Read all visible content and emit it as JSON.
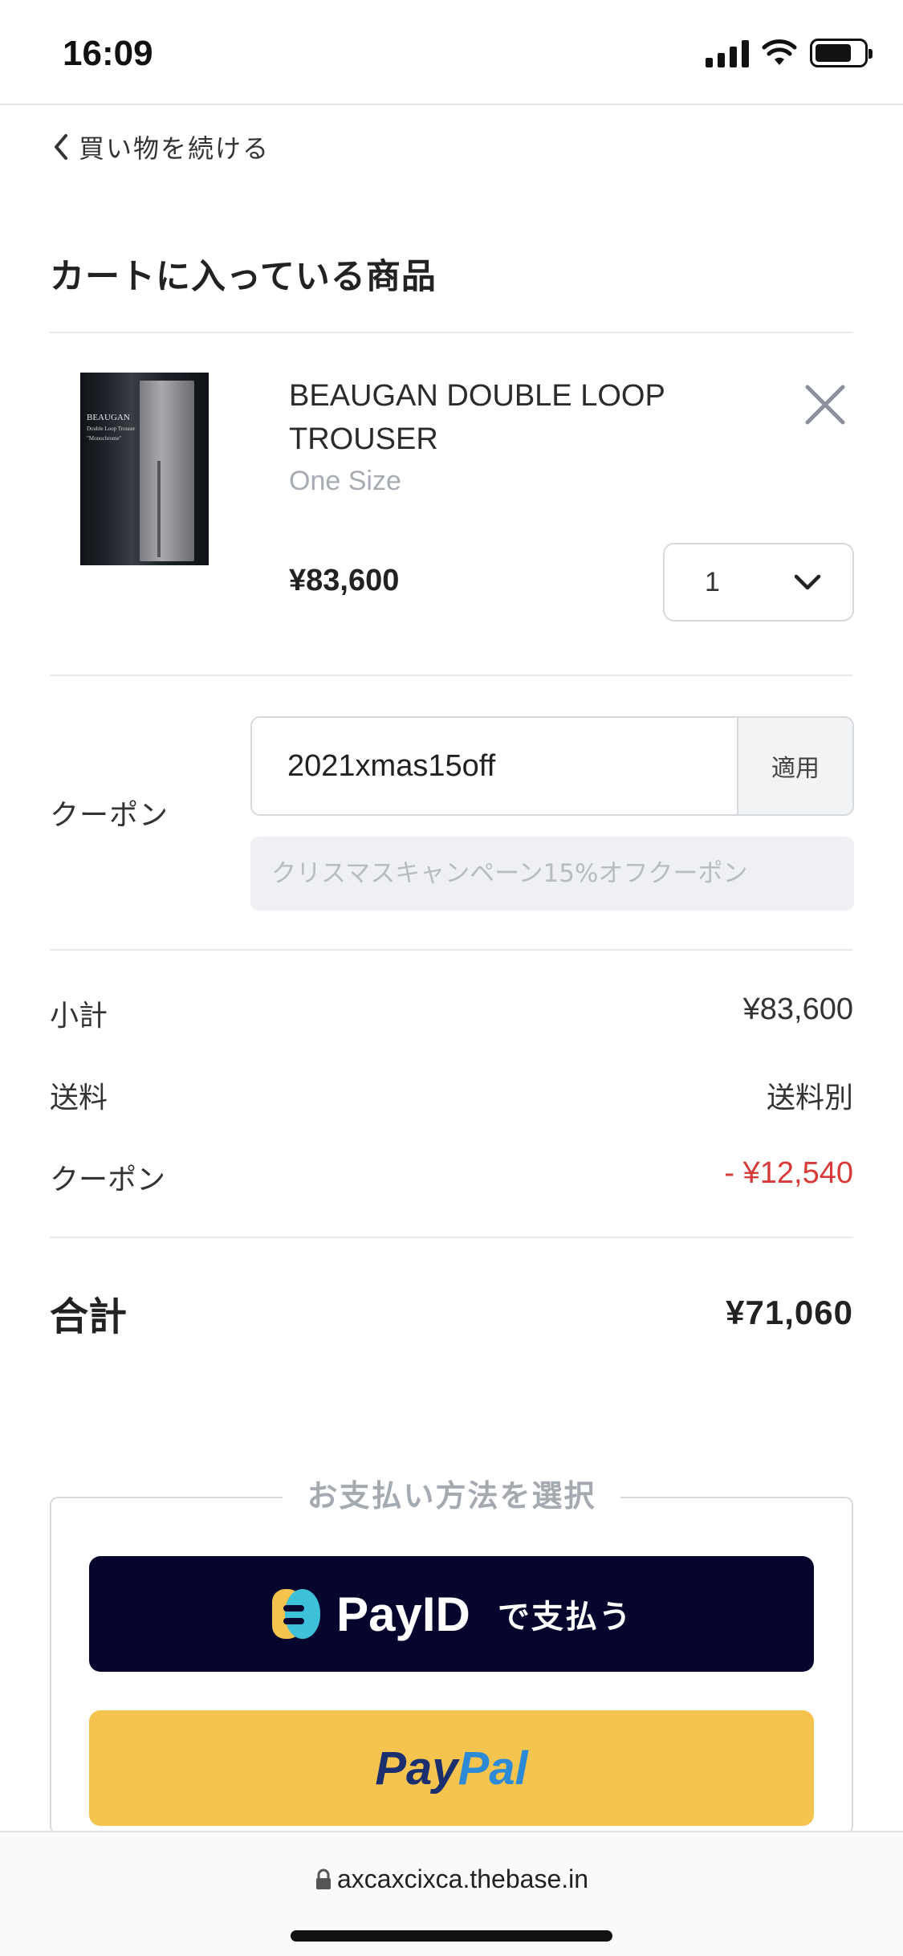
{
  "status_bar": {
    "time": "16:09"
  },
  "back_link": {
    "label": "買い物を続ける"
  },
  "cart": {
    "title": "カートに入っている商品"
  },
  "product": {
    "name": "BEAUGAN DOUBLE LOOP TROUSER",
    "variant": "One Size",
    "price": "¥83,600",
    "quantity": "1",
    "image_text": [
      "BEAUGAN",
      "Double Loop Trouser",
      "\"Monochrome\""
    ]
  },
  "coupon": {
    "label": "クーポン",
    "code": "2021xmas15off",
    "apply_label": "適用",
    "description": "クリスマスキャンペーン15%オフクーポン"
  },
  "summary": {
    "subtotal_label": "小計",
    "subtotal_value": "¥83,600",
    "shipping_label": "送料",
    "shipping_value": "送料別",
    "coupon_label": "クーポン",
    "coupon_value": "- ¥12,540",
    "total_label": "合計",
    "total_value": "¥71,060"
  },
  "payment": {
    "legend": "お支払い方法を選択",
    "payid_brand": "PayID",
    "payid_suffix": "で支払う",
    "paypal_part1": "Pay",
    "paypal_part2": "Pal"
  },
  "browser": {
    "url": "axcaxcixca.thebase.in"
  },
  "colors": {
    "discount": "#d83a3a",
    "payid_bg": "#05052d",
    "paypal_bg": "#f5c44f",
    "paypal_dark": "#1b2f6e",
    "paypal_light": "#2c8ad6",
    "muted_text": "#a5aab1"
  },
  "icons": [
    "signal-icon",
    "wifi-icon",
    "battery-icon",
    "chevron-left-icon",
    "close-icon",
    "chevron-down-icon",
    "payid-logo-icon",
    "lock-icon"
  ]
}
